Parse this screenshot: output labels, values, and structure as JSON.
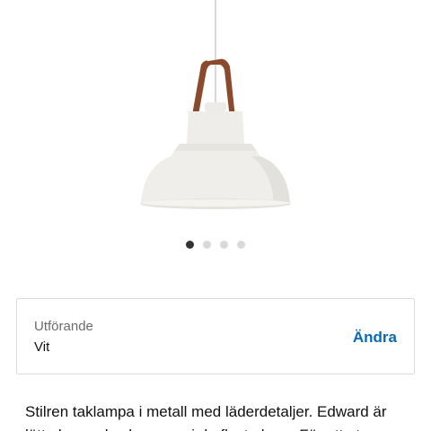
{
  "product": {
    "image_alt": "Taklampa Edward vit",
    "carousel": {
      "count": 4,
      "active_index": 0
    }
  },
  "variant": {
    "label": "Utförande",
    "value": "Vit",
    "change_label": "Ändra"
  },
  "description": {
    "line1": "Stilren taklampa i metall med läderdetaljer. Edward är",
    "line2": "lätt placerad och passar i de flesta hem. För att ut..."
  },
  "colors": {
    "link": "#0a6ab8",
    "lamp_shade": "#efeeea",
    "leather_strap": "#8b4a2b",
    "dot_active": "#333333",
    "dot_inactive": "#d9d9d9"
  }
}
